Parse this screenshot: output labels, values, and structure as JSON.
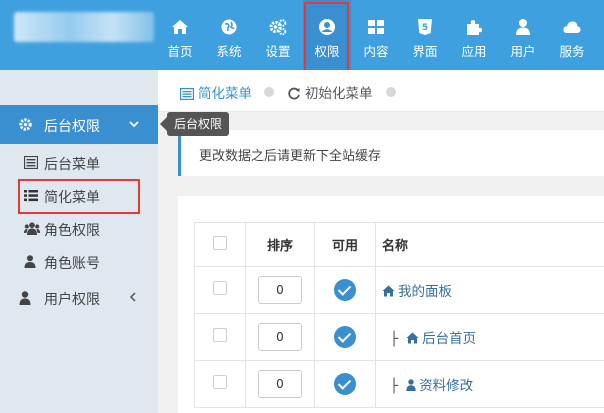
{
  "topnav": {
    "items": [
      {
        "label": "首页",
        "icon": "home-icon"
      },
      {
        "label": "系统",
        "icon": "globe-icon"
      },
      {
        "label": "设置",
        "icon": "gears-icon"
      },
      {
        "label": "权限",
        "icon": "user-circle-icon",
        "active": true
      },
      {
        "label": "内容",
        "icon": "grid-icon"
      },
      {
        "label": "界面",
        "icon": "html5-icon"
      },
      {
        "label": "应用",
        "icon": "puzzle-icon"
      },
      {
        "label": "用户",
        "icon": "user-icon"
      },
      {
        "label": "服务",
        "icon": "cloud-icon"
      }
    ]
  },
  "sidebar": {
    "header": "后台权限",
    "tooltip": "后台权限",
    "items": [
      {
        "label": "后台菜单",
        "icon": "list-alt-icon"
      },
      {
        "label": "简化菜单",
        "icon": "list-icon",
        "selected": true
      },
      {
        "label": "角色权限",
        "icon": "users-icon"
      },
      {
        "label": "角色账号",
        "icon": "user-icon"
      },
      {
        "label": "用户权限",
        "icon": "user-icon"
      }
    ]
  },
  "breadcrumb": {
    "items": [
      {
        "label": "简化菜单",
        "icon": "list-alt-icon"
      },
      {
        "label": "初始化菜单",
        "icon": "refresh-icon"
      }
    ]
  },
  "notice": "更改数据之后请更新下全站缓存",
  "table": {
    "headers": [
      "",
      "排序",
      "可用",
      "名称"
    ],
    "rows": [
      {
        "sort": "0",
        "enabled": true,
        "prefix": "",
        "icon": "home-icon",
        "name": "我的面板"
      },
      {
        "sort": "0",
        "enabled": true,
        "prefix": "├",
        "icon": "home-icon",
        "name": "后台首页"
      },
      {
        "sort": "0",
        "enabled": true,
        "prefix": "├",
        "icon": "user-icon",
        "name": "资料修改"
      }
    ]
  },
  "colors": {
    "topbar": "#3fa0e0",
    "accent": "#3a8fd0",
    "highlight": "#e23a3a",
    "sidebar_bg": "#dfe7ef"
  }
}
